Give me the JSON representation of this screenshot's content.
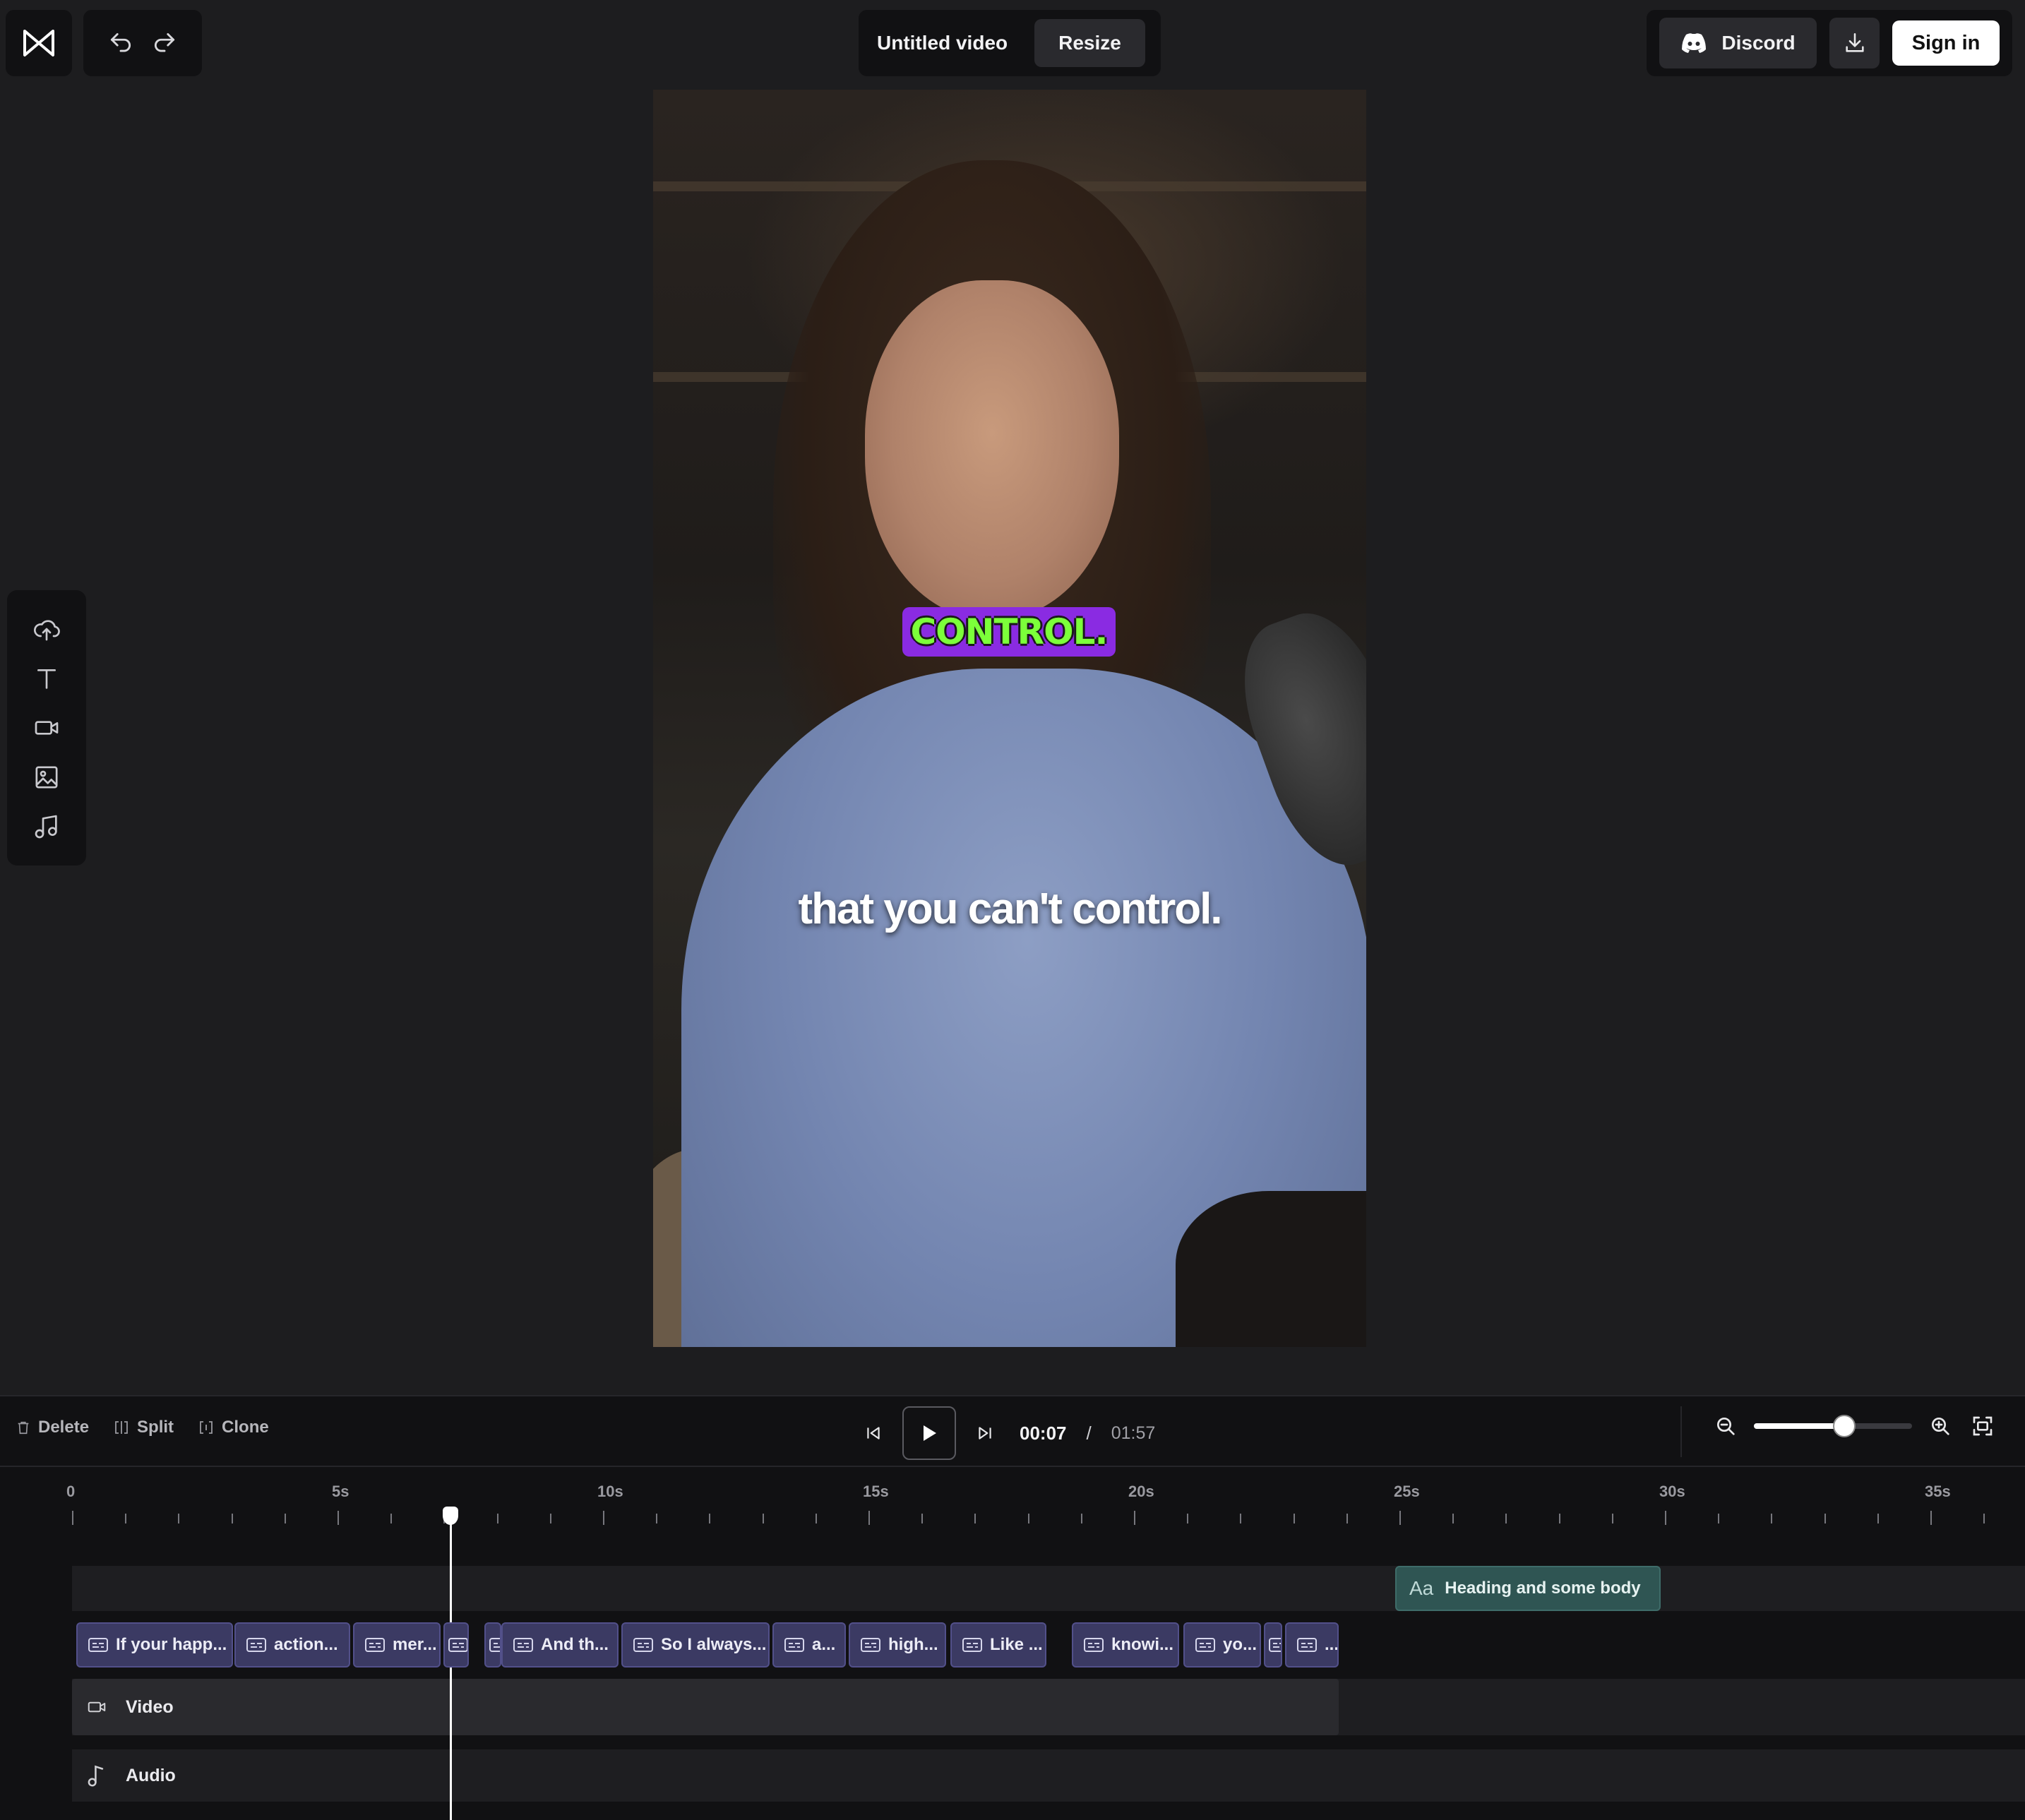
{
  "app": {
    "title": "Untitled video",
    "resize_label": "Resize",
    "discord_label": "Discord",
    "signin_label": "Sign in"
  },
  "icons": {
    "logo": "bowtie-logo-icon",
    "undo": "undo-icon",
    "redo": "redo-icon",
    "discord": "discord-icon",
    "download": "download-icon",
    "upload": "upload-icon",
    "text": "text-icon",
    "video": "video-icon",
    "image": "image-icon",
    "music": "music-icon"
  },
  "preview": {
    "highlight_word": "CONTROL.",
    "subtitle": "that you can't control."
  },
  "editor": {
    "delete_label": "Delete",
    "split_label": "Split",
    "clone_label": "Clone",
    "time_current": "00:07",
    "time_separator": "/",
    "time_total": "01:57",
    "zoom_fraction": 0.57
  },
  "ruler": {
    "labels": [
      "0",
      "5s",
      "10s",
      "15s",
      "20s",
      "25s",
      "30s",
      "35s"
    ]
  },
  "tracks": {
    "text_clip_label": "Heading and some body",
    "text_clip_icon": "Aa",
    "video_label": "Video",
    "audio_label": "Audio",
    "caption_clips": [
      "If your happ...",
      "action...",
      "mer...",
      "",
      "",
      "And th...",
      "So I always...",
      "a...",
      "high...",
      "Like ...",
      "knowi...",
      "yo...",
      "",
      "..."
    ]
  },
  "colors": {
    "background": "#1d1d1f",
    "panel": "#111113",
    "caption_clip": "#3b3a63",
    "text_clip": "#2f5553",
    "highlight_bg": "#8a2be2",
    "highlight_text": "#7cff3a"
  }
}
